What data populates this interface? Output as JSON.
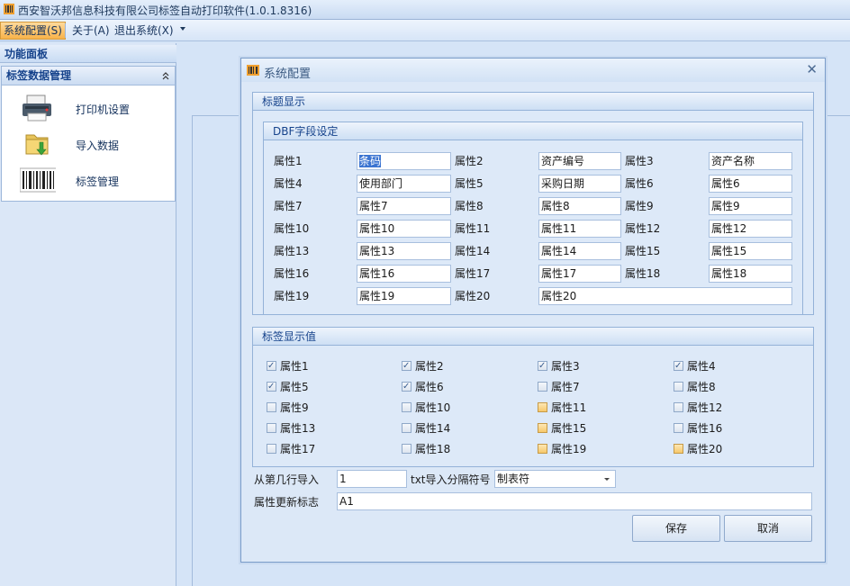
{
  "window": {
    "title": "西安智沃邦信息科技有限公司标签自动打印软件(1.0.1.8316)",
    "icon": "app-barcode-icon"
  },
  "menu": {
    "items": [
      "系统配置(S)",
      "关于(A)",
      "退出系统(X)"
    ]
  },
  "sidebar": {
    "panel_title": "功能面板",
    "group_title": "标签数据管理",
    "items": [
      {
        "label": "打印机设置",
        "icon": "printer-icon"
      },
      {
        "label": "导入数据",
        "icon": "import-folder-icon"
      },
      {
        "label": "标签管理",
        "icon": "barcode-icon"
      }
    ]
  },
  "dialog": {
    "title": "系统配置",
    "title_section": "标题显示",
    "dbf_section": "DBF字段设定",
    "fields": [
      {
        "label": "属性1",
        "value": "条码"
      },
      {
        "label": "属性2",
        "value": "资产编号"
      },
      {
        "label": "属性3",
        "value": "资产名称"
      },
      {
        "label": "属性4",
        "value": "使用部门"
      },
      {
        "label": "属性5",
        "value": "采购日期"
      },
      {
        "label": "属性6",
        "value": "属性6"
      },
      {
        "label": "属性7",
        "value": "属性7"
      },
      {
        "label": "属性8",
        "value": "属性8"
      },
      {
        "label": "属性9",
        "value": "属性9"
      },
      {
        "label": "属性10",
        "value": "属性10"
      },
      {
        "label": "属性11",
        "value": "属性11"
      },
      {
        "label": "属性12",
        "value": "属性12"
      },
      {
        "label": "属性13",
        "value": "属性13"
      },
      {
        "label": "属性14",
        "value": "属性14"
      },
      {
        "label": "属性15",
        "value": "属性15"
      },
      {
        "label": "属性16",
        "value": "属性16"
      },
      {
        "label": "属性17",
        "value": "属性17"
      },
      {
        "label": "属性18",
        "value": "属性18"
      },
      {
        "label": "属性19",
        "value": "属性19"
      },
      {
        "label": "属性20",
        "value": "属性20"
      }
    ],
    "display_section": "标签显示值",
    "checkboxes": [
      {
        "label": "属性1",
        "checked": true,
        "hot": false
      },
      {
        "label": "属性2",
        "checked": true,
        "hot": false
      },
      {
        "label": "属性3",
        "checked": true,
        "hot": false
      },
      {
        "label": "属性4",
        "checked": true,
        "hot": false
      },
      {
        "label": "属性5",
        "checked": true,
        "hot": false
      },
      {
        "label": "属性6",
        "checked": true,
        "hot": false
      },
      {
        "label": "属性7",
        "checked": false,
        "hot": false
      },
      {
        "label": "属性8",
        "checked": false,
        "hot": false
      },
      {
        "label": "属性9",
        "checked": false,
        "hot": false
      },
      {
        "label": "属性10",
        "checked": false,
        "hot": false
      },
      {
        "label": "属性11",
        "checked": false,
        "hot": true
      },
      {
        "label": "属性12",
        "checked": false,
        "hot": false
      },
      {
        "label": "属性13",
        "checked": false,
        "hot": false
      },
      {
        "label": "属性14",
        "checked": false,
        "hot": false
      },
      {
        "label": "属性15",
        "checked": false,
        "hot": true
      },
      {
        "label": "属性16",
        "checked": false,
        "hot": false
      },
      {
        "label": "属性17",
        "checked": false,
        "hot": false
      },
      {
        "label": "属性18",
        "checked": false,
        "hot": false
      },
      {
        "label": "属性19",
        "checked": false,
        "hot": true
      },
      {
        "label": "属性20",
        "checked": false,
        "hot": true
      }
    ],
    "start_row_label": "从第几行导入",
    "start_row_value": "1",
    "separator_label": "txt导入分隔符号",
    "separator_value": "制表符",
    "update_flag_label": "属性更新标志",
    "update_flag_value": "A1",
    "save_label": "保存",
    "cancel_label": "取消"
  },
  "colors": {
    "accent": "#f8b34a",
    "header_text": "#15428b",
    "background": "#d5e4f7"
  }
}
